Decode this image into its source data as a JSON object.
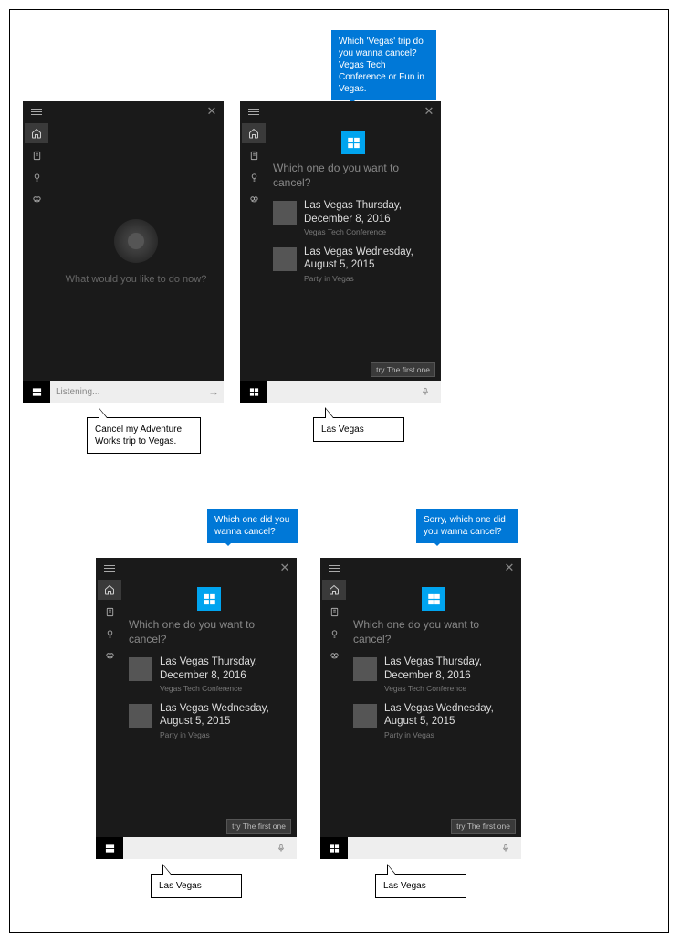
{
  "panes": [
    {
      "idle_prompt": "What would you like to do now?",
      "search_placeholder": "Listening...",
      "callout": "Cancel my Adventure Works trip to Vegas."
    },
    {
      "blue_tip": "Which 'Vegas' trip do you wanna cancel? Vegas Tech Conference or Fun in Vegas.",
      "question": "Which one do you want to cancel?",
      "trips": [
        {
          "title": "Las Vegas Thursday, December 8, 2016",
          "sub": "Vegas Tech Conference"
        },
        {
          "title": "Las Vegas Wednesday, August 5, 2015",
          "sub": "Party in Vegas"
        }
      ],
      "hint": "try The first one",
      "callout": "Las Vegas"
    },
    {
      "blue_tip": "Which one did you wanna cancel?",
      "question": "Which one do you want to cancel?",
      "trips": [
        {
          "title": "Las Vegas Thursday, December 8, 2016",
          "sub": "Vegas Tech Conference"
        },
        {
          "title": "Las Vegas Wednesday, August 5, 2015",
          "sub": "Party in Vegas"
        }
      ],
      "hint": "try The first one",
      "callout": "Las Vegas"
    },
    {
      "blue_tip": "Sorry, which one did you wanna cancel?",
      "question": "Which one do you want to cancel?",
      "trips": [
        {
          "title": "Las Vegas Thursday, December 8, 2016",
          "sub": "Vegas Tech Conference"
        },
        {
          "title": "Las Vegas Wednesday, August 5, 2015",
          "sub": "Party in Vegas"
        }
      ],
      "hint": "try The first one",
      "callout": "Las Vegas"
    }
  ]
}
